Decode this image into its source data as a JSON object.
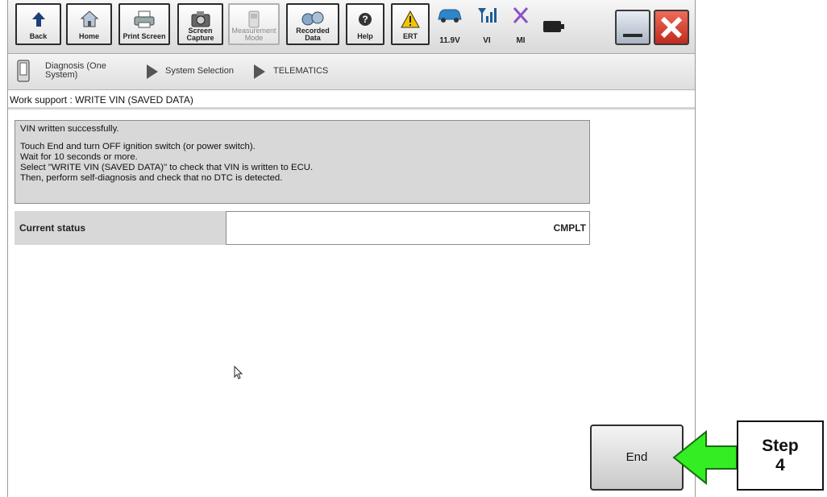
{
  "toolbar": {
    "buttons": [
      {
        "label": "Back",
        "icon": "back-arrow-icon"
      },
      {
        "label": "Home",
        "icon": "home-icon"
      },
      {
        "label": "Print Screen",
        "icon": "printer-icon"
      },
      {
        "label": "Screen Capture",
        "icon": "camera-icon"
      },
      {
        "label": "Measurement Mode",
        "icon": "meter-icon"
      },
      {
        "label": "Recorded Data",
        "icon": "recorded-data-icon"
      },
      {
        "label": "Help",
        "icon": "help-icon"
      },
      {
        "label": "ERT",
        "icon": "warning-icon"
      }
    ],
    "status": {
      "voltage": "11.9V",
      "vi": "VI",
      "mi": "MI"
    }
  },
  "breadcrumb": {
    "items": [
      "Diagnosis (One System)",
      "System Selection",
      "TELEMATICS"
    ]
  },
  "page": {
    "title": "Work support : WRITE VIN (SAVED DATA)",
    "message_lines": [
      "VIN written successfully.",
      "",
      "Touch End and turn OFF ignition switch (or power switch).",
      "Wait for 10 seconds or more.",
      "Select \"WRITE VIN (SAVED DATA)\" to check that VIN is written to ECU.",
      "Then, perform self-diagnosis and check that no DTC is detected."
    ],
    "status_label": "Current status",
    "status_value": "CMPLT",
    "end_label": "End"
  },
  "annotation": {
    "step_word": "Step",
    "step_number": "4"
  },
  "colors": {
    "arrow_fill": "#33ee22",
    "close_red": "#d93a2b"
  }
}
